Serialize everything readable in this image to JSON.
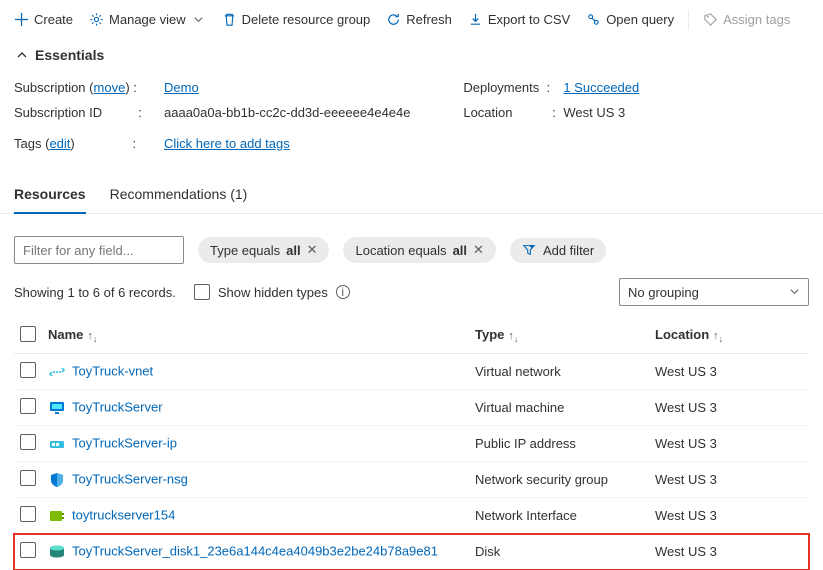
{
  "toolbar": {
    "create": "Create",
    "manage_view": "Manage view",
    "delete": "Delete resource group",
    "refresh": "Refresh",
    "export": "Export to CSV",
    "open_query": "Open query",
    "assign_tags": "Assign tags"
  },
  "essentials": {
    "header": "Essentials",
    "subscription_label": "Subscription",
    "subscription_move": "move",
    "subscription_value": "Demo",
    "subscription_id_label": "Subscription ID",
    "subscription_id_value": "aaaa0a0a-bb1b-cc2c-dd3d-eeeeee4e4e4e",
    "tags_label": "Tags",
    "tags_edit": "edit",
    "tags_value": "Click here to add tags",
    "deployments_label": "Deployments",
    "deployments_value": "1 Succeeded",
    "location_label": "Location",
    "location_value": "West US 3"
  },
  "tabs": {
    "resources": "Resources",
    "recommendations": "Recommendations (1)"
  },
  "filters": {
    "placeholder": "Filter for any field...",
    "type_prefix": "Type equals ",
    "type_value": "all",
    "location_prefix": "Location equals ",
    "location_value": "all",
    "add_filter": "Add filter"
  },
  "meta": {
    "showing": "Showing 1 to 6 of 6 records.",
    "show_hidden": "Show hidden types",
    "no_grouping": "No grouping"
  },
  "columns": {
    "name": "Name",
    "type": "Type",
    "location": "Location"
  },
  "rows": [
    {
      "name": "ToyTruck-vnet",
      "type": "Virtual network",
      "location": "West US 3",
      "icon": "vnet"
    },
    {
      "name": "ToyTruckServer",
      "type": "Virtual machine",
      "location": "West US 3",
      "icon": "vm"
    },
    {
      "name": "ToyTruckServer-ip",
      "type": "Public IP address",
      "location": "West US 3",
      "icon": "ip"
    },
    {
      "name": "ToyTruckServer-nsg",
      "type": "Network security group",
      "location": "West US 3",
      "icon": "nsg"
    },
    {
      "name": "toytruckserver154",
      "type": "Network Interface",
      "location": "West US 3",
      "icon": "nic"
    },
    {
      "name": "ToyTruckServer_disk1_23e6a144c4ea4049b3e2be24b78a9e81",
      "type": "Disk",
      "location": "West US 3",
      "icon": "disk",
      "highlight": true
    }
  ]
}
